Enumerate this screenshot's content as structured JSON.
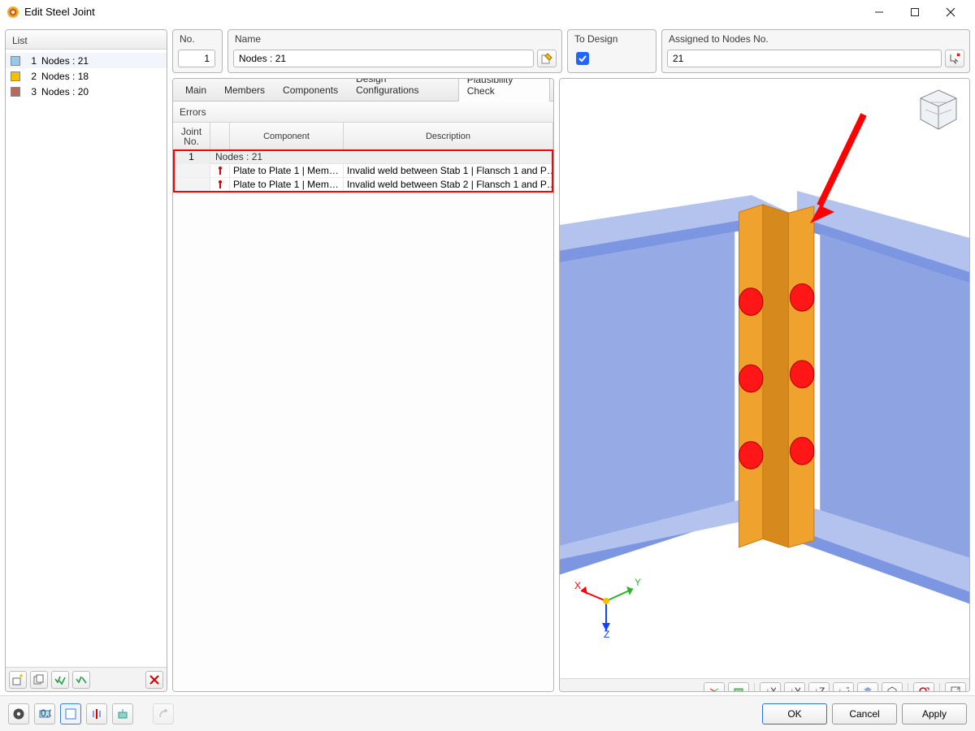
{
  "window": {
    "title": "Edit Steel Joint"
  },
  "sidebar": {
    "header": "List",
    "items": [
      {
        "num": "1",
        "label": "Nodes : 21",
        "color": "#96c8ea"
      },
      {
        "num": "2",
        "label": "Nodes : 18",
        "color": "#f2c200"
      },
      {
        "num": "3",
        "label": "Nodes : 20",
        "color": "#b36b5f"
      }
    ]
  },
  "fields": {
    "no": {
      "label": "No.",
      "value": "1"
    },
    "name": {
      "label": "Name",
      "value": "Nodes : 21"
    },
    "design": {
      "label": "To Design",
      "checked": true
    },
    "nodes": {
      "label": "Assigned to Nodes No.",
      "value": "21"
    }
  },
  "tabs": {
    "items": [
      "Main",
      "Members",
      "Components",
      "Design Configurations",
      "Plausibility Check"
    ],
    "active": 4
  },
  "errors": {
    "panel_title": "Errors",
    "columns": {
      "joint": "Joint\nNo.",
      "component": "Component",
      "description": "Description"
    },
    "group": {
      "joint_no": "1",
      "label": "Nodes : 21"
    },
    "rows": [
      {
        "component": "Plate to Plate 1 | Mem…",
        "description": "Invalid weld between Stab 1 | Flansch 1 and P…"
      },
      {
        "component": "Plate to Plate 1 | Mem…",
        "description": "Invalid weld between Stab 2 | Flansch 1 and P…"
      }
    ]
  },
  "axis": {
    "x": "X",
    "y": "Y",
    "z": "Z"
  },
  "buttons": {
    "ok": "OK",
    "cancel": "Cancel",
    "apply": "Apply"
  },
  "colors": {
    "beam_face": "#7d96e2",
    "beam_edge": "#9cb1e8",
    "beam_top": "#b3c3ee",
    "plate": "#f0a22e",
    "bolt": "#ff1616"
  }
}
